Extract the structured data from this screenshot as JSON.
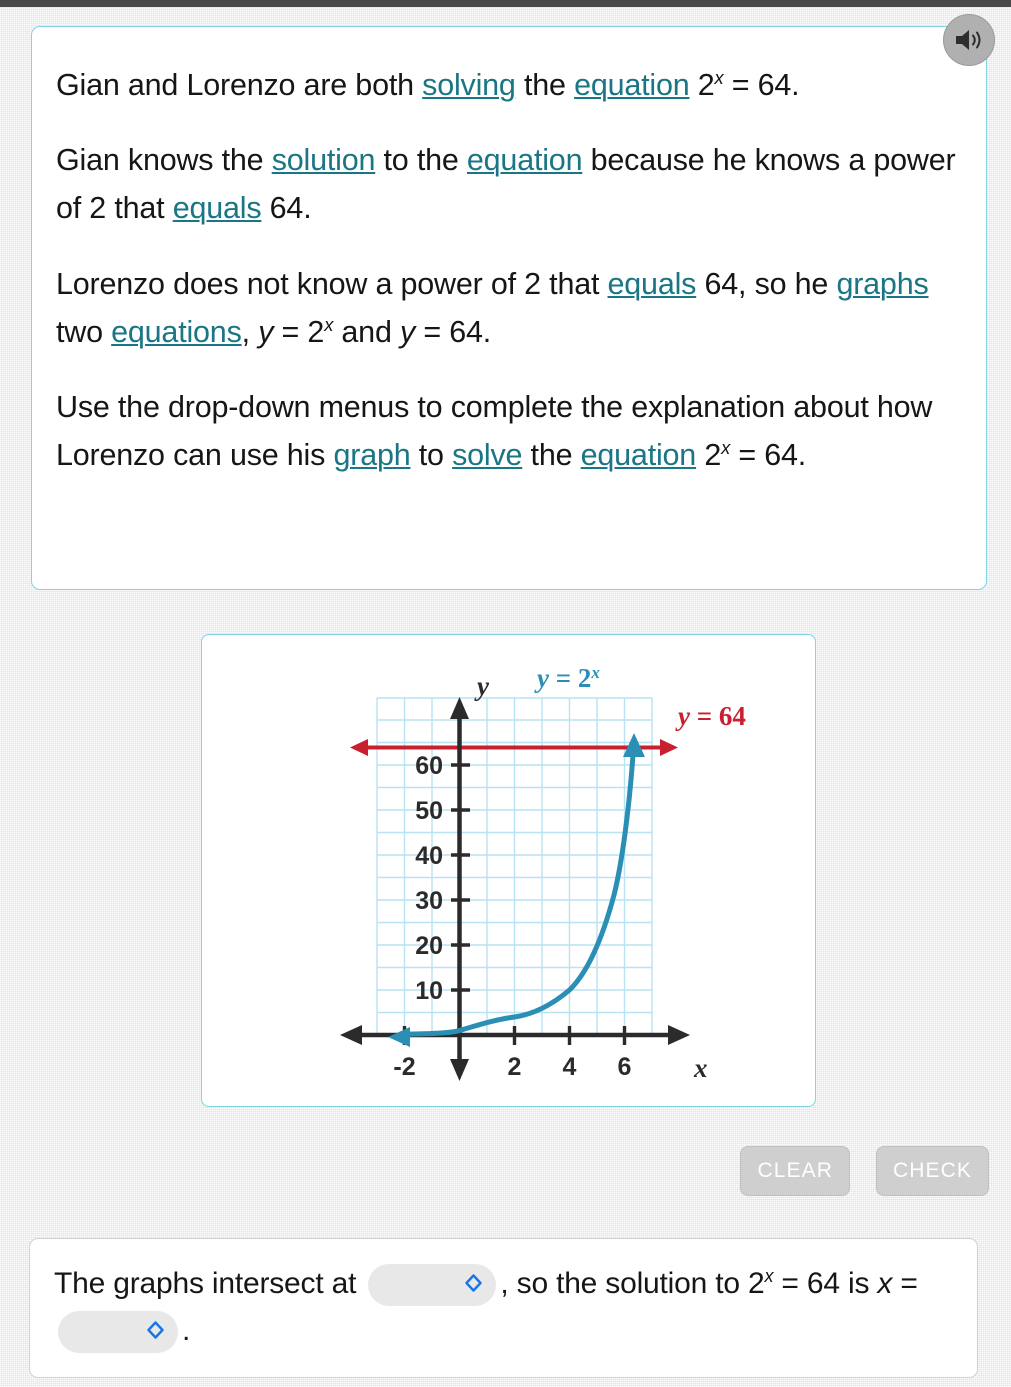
{
  "top_bar": {
    "present": true
  },
  "speaker": {
    "icon": "speaker-icon",
    "label": "Play audio"
  },
  "prompt": {
    "paragraph_1": {
      "segments": [
        {
          "text": "Gian and Lorenzo are both ",
          "type": "plain"
        },
        {
          "text": "solving",
          "type": "link"
        },
        {
          "text": " the ",
          "type": "plain"
        },
        {
          "text": "equation",
          "type": "link"
        },
        {
          "text": " 2",
          "type": "plain"
        },
        {
          "text": "x",
          "type": "sup"
        },
        {
          "text": " = 64.",
          "type": "plain"
        }
      ]
    },
    "paragraph_2": {
      "segments": [
        {
          "text": "Gian knows the ",
          "type": "plain"
        },
        {
          "text": "solution",
          "type": "link"
        },
        {
          "text": " to the ",
          "type": "plain"
        },
        {
          "text": "equation",
          "type": "link"
        },
        {
          "text": " because he knows a power of 2 that ",
          "type": "plain"
        },
        {
          "text": "equals",
          "type": "link"
        },
        {
          "text": " 64.",
          "type": "plain"
        }
      ]
    },
    "paragraph_3": {
      "segments": [
        {
          "text": "Lorenzo does not know a power of 2 that ",
          "type": "plain"
        },
        {
          "text": "equals",
          "type": "link"
        },
        {
          "text": " 64, so he ",
          "type": "plain"
        },
        {
          "text": "graphs",
          "type": "link"
        },
        {
          "text": " two ",
          "type": "plain"
        },
        {
          "text": "equations",
          "type": "link"
        },
        {
          "text": ", ",
          "type": "plain"
        },
        {
          "text": "y",
          "type": "var"
        },
        {
          "text": " = 2",
          "type": "plain"
        },
        {
          "text": "x",
          "type": "sup"
        },
        {
          "text": " and ",
          "type": "plain"
        },
        {
          "text": "y",
          "type": "var"
        },
        {
          "text": " = 64.",
          "type": "plain"
        }
      ]
    },
    "paragraph_4": {
      "segments": [
        {
          "text": "Use the drop-down menus to complete the explanation about how Lorenzo can use his ",
          "type": "plain"
        },
        {
          "text": "graph",
          "type": "link"
        },
        {
          "text": " to ",
          "type": "plain"
        },
        {
          "text": "solve",
          "type": "link"
        },
        {
          "text": " the ",
          "type": "plain"
        },
        {
          "text": "equation",
          "type": "link"
        },
        {
          "text": " 2",
          "type": "plain"
        },
        {
          "text": "x",
          "type": "sup"
        },
        {
          "text": " = 64.",
          "type": "plain"
        }
      ]
    }
  },
  "chart_data": {
    "type": "line",
    "title": "",
    "xlabel": "x",
    "ylabel": "y",
    "xlim": [
      -3,
      7
    ],
    "ylim": [
      -5,
      70
    ],
    "grid": true,
    "grid_x_step": 1,
    "grid_y_step": 5,
    "x_ticks": [
      -2,
      2,
      4,
      6
    ],
    "x_tick_labels": [
      "-2",
      "2",
      "4",
      "6"
    ],
    "y_ticks": [
      10,
      20,
      30,
      40,
      50,
      60
    ],
    "y_tick_labels": [
      "10",
      "20",
      "30",
      "40",
      "50",
      "60"
    ],
    "legend_position": "inline-annotations",
    "series": [
      {
        "name": "y = 2^x",
        "label": "y = 2",
        "label_sup": "x",
        "color": "#2b8fb5",
        "type": "exponential",
        "base": 2,
        "x": [
          -3,
          -2,
          -1,
          0,
          1,
          2,
          3,
          4,
          5,
          6
        ],
        "values": [
          0.125,
          0.25,
          0.5,
          1,
          2,
          4,
          8,
          16,
          32,
          64
        ],
        "arrow_start": true,
        "arrow_end": true
      },
      {
        "name": "y = 64",
        "label": "y = 64",
        "color": "#c8202f",
        "type": "horizontal-line",
        "y_value": 64,
        "arrow_start": true,
        "arrow_end": true
      }
    ],
    "annotations": [
      {
        "text": "y = 64",
        "color": "#c8202f",
        "x": 7.2,
        "y": 67
      },
      {
        "text": "y = 2",
        "sup": "x",
        "color": "#2b8fb5",
        "x": 4.0,
        "y": 70
      }
    ]
  },
  "actions": {
    "clear_label": "CLEAR",
    "check_label": "CHECK",
    "disabled": true
  },
  "answer": {
    "lead_text": "The graphs intersect at",
    "dropdown_1": {
      "value": "",
      "placeholder": "",
      "icon": "chevron-updown-icon"
    },
    "mid_text_a": ", so the solution to 2",
    "mid_text_sup": "x",
    "mid_text_b": " = 64 is ",
    "var_x": "x",
    "equals": " = ",
    "dropdown_2": {
      "value": "",
      "placeholder": "",
      "icon": "chevron-updown-icon"
    },
    "period": "."
  },
  "colors": {
    "link": "#1a7684",
    "card_border": "#7fd6e2",
    "curve_blue": "#2b8fb5",
    "line_red": "#c8202f",
    "grid": "#b9e2f2",
    "axis": "#2b2b2b",
    "page_bg": "#e9e9e9",
    "dropdown_chevron": "#1a73e8"
  }
}
